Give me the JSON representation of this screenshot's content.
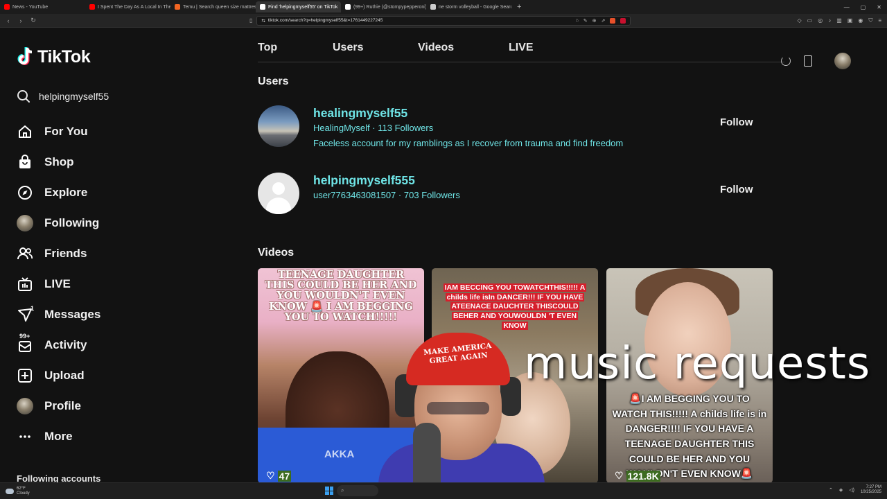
{
  "browser": {
    "tabs": [
      {
        "title": "News - YouTube",
        "color": "#ff0000",
        "active": false
      },
      {
        "title": "I Spent The Day As A Local In The Ph",
        "color": "#ff0000",
        "active": false
      },
      {
        "title": "Temu | Search queen size mattress",
        "color": "#f26522",
        "active": false
      },
      {
        "title": "Find 'helpingmyself55' on TikTok",
        "color": "#ffffff",
        "active": true
      },
      {
        "title": "(99+) Ruthie (@stompypepperoni) | Ti",
        "color": "#ffffff",
        "active": false
      },
      {
        "title": "ne storm volleyball - Google Search",
        "color": "#cccccc",
        "active": false
      }
    ],
    "new_tab": "+",
    "url": "tiktok.com/search?q=helpingmyself55&t=1761449227245"
  },
  "app": {
    "logo": "TikTok",
    "search_value": "helpingmyself55",
    "nav": [
      {
        "label": "For You",
        "icon": "home-icon"
      },
      {
        "label": "Shop",
        "icon": "shop-bag-icon"
      },
      {
        "label": "Explore",
        "icon": "compass-icon"
      },
      {
        "label": "Following",
        "icon": "following-avatar"
      },
      {
        "label": "Friends",
        "icon": "friends-icon"
      },
      {
        "label": "LIVE",
        "icon": "live-tv-icon"
      },
      {
        "label": "Messages",
        "icon": "messages-icon",
        "badge": "1"
      },
      {
        "label": "Activity",
        "icon": "activity-icon",
        "badge": "99+"
      },
      {
        "label": "Upload",
        "icon": "upload-icon"
      },
      {
        "label": "Profile",
        "icon": "profile-avatar"
      },
      {
        "label": "More",
        "icon": "more-icon"
      }
    ],
    "following_accounts": "Following accounts"
  },
  "results": {
    "tabs": [
      "Top",
      "Users",
      "Videos",
      "LIVE"
    ],
    "active_tab": "Top",
    "users_title": "Users",
    "users": [
      {
        "username": "healingmyself55",
        "display": "HealingMyself",
        "followers_count": "113",
        "followers_label": "Followers",
        "bio": "Faceless account for my ramblings as I recover from trauma and find freedom",
        "follow_label": "Follow"
      },
      {
        "username": "helpingmyself555",
        "display": "user7763463081507",
        "followers_count": "703",
        "followers_label": "Followers",
        "bio": "",
        "follow_label": "Follow"
      }
    ],
    "separator": "·",
    "videos_title": "Videos",
    "videos": [
      {
        "caption": "TEENAGE DAUGHTER THIS COULD BE HER AND YOU WOULDN'T EVEN KNOW 🚨 I AM BEGGING YOU TO WATCH!!!!!",
        "overlay": "AKKA",
        "likes": "47"
      },
      {
        "caption": "IAM BECCING YOU TOWATCHTHIS!!!!! A childs life isIn DANCER!!! IF YOU HAVE ATEENACE DAUCHTER THISCOULD BEHER AND YOUWOULDN 'T EVEN KNOW",
        "likes": ""
      },
      {
        "caption": "🚨I AM BEGGING YOU TO WATCH THIS!!!!! A childs life is in DANGER!!!! IF YOU HAVE A TEENAGE DAUGHTER THIS COULD BE HER AND YOU WOULDN'T EVEN KNOW🚨",
        "likes": "121.8K"
      }
    ]
  },
  "stream_overlay": {
    "text": "music requests",
    "hat_text": "MAKE AMERICA GREAT AGAIN"
  },
  "taskbar": {
    "temp": "62°F",
    "weather": "Cloudy",
    "time": "7:27 PM",
    "date": "10/25/2025"
  }
}
